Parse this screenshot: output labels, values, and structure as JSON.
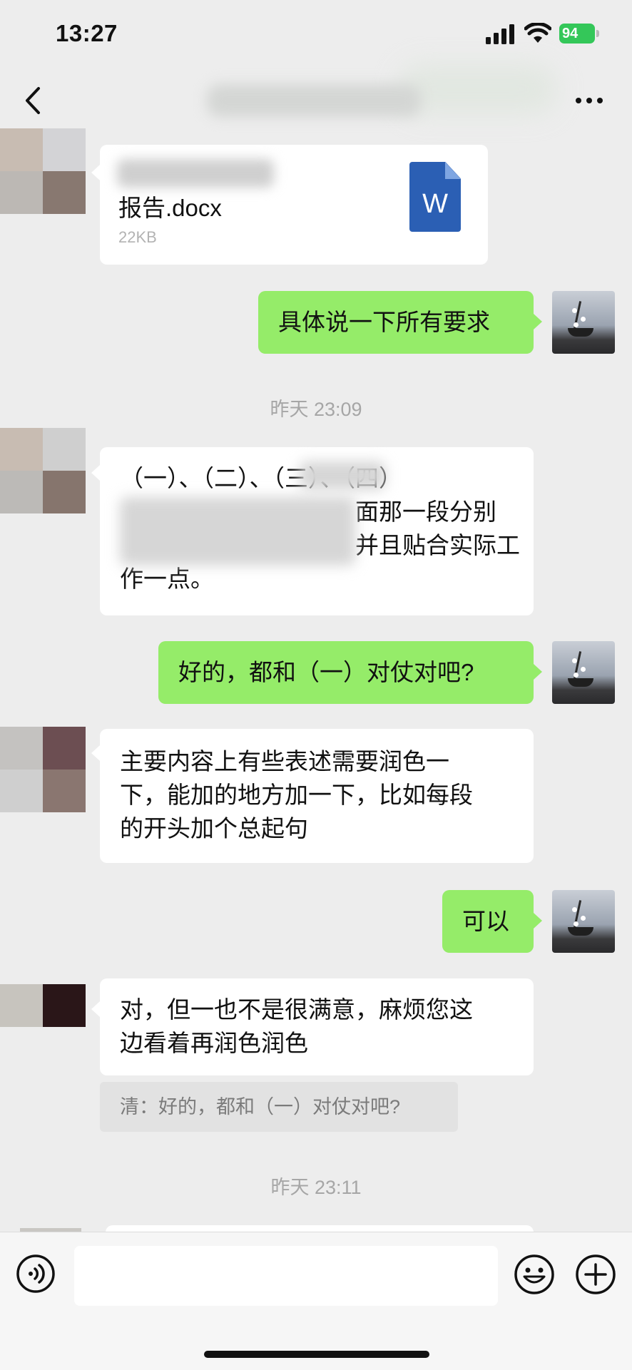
{
  "status_bar": {
    "time": "13:27",
    "battery": "94"
  },
  "messages": {
    "file": {
      "name": "报告.docx",
      "size": "22KB",
      "icon_letter": "W"
    },
    "m1_out": "具体说一下所有要求",
    "ts1": "昨天 23:09",
    "m2_in": {
      "line1": "（一）、（二）、（三）、（四）",
      "line2": "面那一段分别",
      "line3": "并且贴合实际工",
      "line4": "作一点。"
    },
    "m3_out": "好的，都和（一）对仗对吧?",
    "m4_in": {
      "line1": "主要内容上有些表述需要润色一",
      "line2": "下，能加的地方加一下，比如每段",
      "line3": "的开头加个总起句"
    },
    "m5_out": "可以",
    "m6_in": {
      "line1": "对，但一也不是很满意，麻烦您这",
      "line2": "边看着再润色润色"
    },
    "quote": "清：好的，都和（一）对仗对吧?",
    "ts2": "昨天 23:11"
  },
  "icons": {
    "back": "chevron-left-icon",
    "more": "ellipsis-icon",
    "voice": "voice-icon",
    "emoji": "emoji-icon",
    "plus": "plus-circle-icon"
  },
  "colors": {
    "outgoing_bubble": "#95ec69",
    "incoming_bubble": "#ffffff",
    "background": "#ededed",
    "word_blue": "#2b5fb4"
  }
}
